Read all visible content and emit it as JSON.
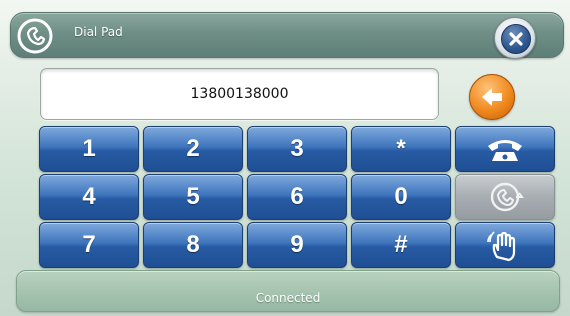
{
  "header": {
    "title": "Dial Pad",
    "icon": "phone-handset-icon",
    "close_icon": "close-icon"
  },
  "display": {
    "number": "13800138000"
  },
  "backspace": {
    "icon": "backspace-arrow-icon"
  },
  "keypad": {
    "row1": [
      "1",
      "2",
      "3",
      "*"
    ],
    "row2": [
      "4",
      "5",
      "6",
      "0"
    ],
    "row3": [
      "7",
      "8",
      "9",
      "#"
    ]
  },
  "actions": {
    "call_icon": "phone-call-icon",
    "transfer_icon": "phone-transfer-icon",
    "hold_icon": "hand-icon"
  },
  "status": {
    "text": "Connected"
  },
  "colors": {
    "key_blue": "#275ba4",
    "key_disabled": "#a7adb2",
    "backspace_orange": "#f08a1e",
    "close_blue": "#2d5690"
  }
}
